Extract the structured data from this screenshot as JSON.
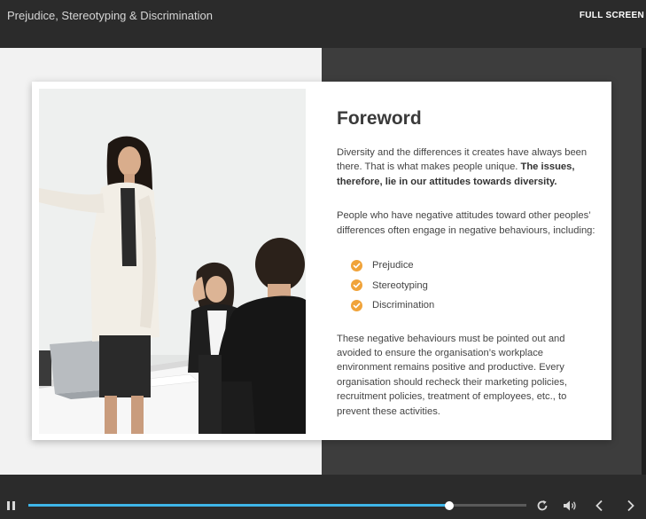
{
  "header": {
    "course_title": "Prejudice, Stereotyping & Discrimination",
    "fullscreen_label": "FULL SCREEN"
  },
  "slide": {
    "heading": "Foreword",
    "para1_plain": "Diversity and the differences it creates have always been there. That is what makes people unique. ",
    "para1_bold": "The issues, therefore, lie in our attitudes towards diversity.",
    "para2": "People who have negative attitudes toward other peoples’ differences often engage in negative behaviours, including:",
    "bullets": [
      "Prejudice",
      "Stereotyping",
      "Discrimination"
    ],
    "para3": "These negative behaviours must be pointed out and avoided to ensure the organisation’s workplace environment remains positive and productive. Every organisation should recheck their marketing policies, recruitment policies, treatment of employees, etc., to prevent these activities.",
    "check_color": "#f0a33a"
  },
  "player": {
    "progress_fraction": 0.846,
    "accent": "#3fb6e8",
    "icons": {
      "pause": "pause-icon",
      "replay": "replay-icon",
      "volume": "volume-icon",
      "prev": "chevron-left-icon",
      "next": "chevron-right-icon"
    }
  }
}
